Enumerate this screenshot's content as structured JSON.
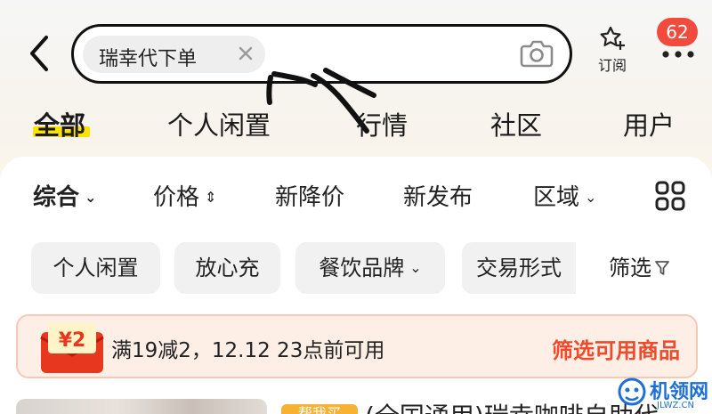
{
  "search": {
    "query_chip": "瑞幸代下单",
    "close_glyph": "×"
  },
  "header": {
    "favorite_label": "订阅",
    "message_count": "62"
  },
  "tabs": [
    {
      "label": "全部",
      "active": true
    },
    {
      "label": "个人闲置",
      "active": false
    },
    {
      "label": "行情",
      "active": false
    },
    {
      "label": "社区",
      "active": false
    },
    {
      "label": "用户",
      "active": false
    }
  ],
  "sort": {
    "items": [
      {
        "label": "综合",
        "arrow": "⌄",
        "active": true
      },
      {
        "label": "价格",
        "arrow": "⇕",
        "active": false
      },
      {
        "label": "新降价",
        "arrow": "",
        "active": false
      },
      {
        "label": "新发布",
        "arrow": "",
        "active": false
      },
      {
        "label": "区域",
        "arrow": "⌄",
        "active": false
      }
    ]
  },
  "filters": {
    "chips": [
      "个人闲置",
      "放心充",
      "餐饮品牌",
      "交易形式"
    ],
    "chip_arrow": "⌄",
    "filter_label": "筛选"
  },
  "coupon": {
    "badge_text": "¥2",
    "text": "满19减2，12.12 23点前可用",
    "action": "筛选可用商品"
  },
  "product": {
    "tag": "帮我买",
    "title": "(全国通用)瑞幸咖啡自助代"
  },
  "watermark": {
    "text": "机领网",
    "sub": "JLWZ.CN"
  },
  "colors": {
    "accent_yellow": "#ffe100",
    "badge_red": "#f24a3c",
    "coupon_orange": "#f04a2a",
    "watermark_blue": "#1e6fd6"
  }
}
